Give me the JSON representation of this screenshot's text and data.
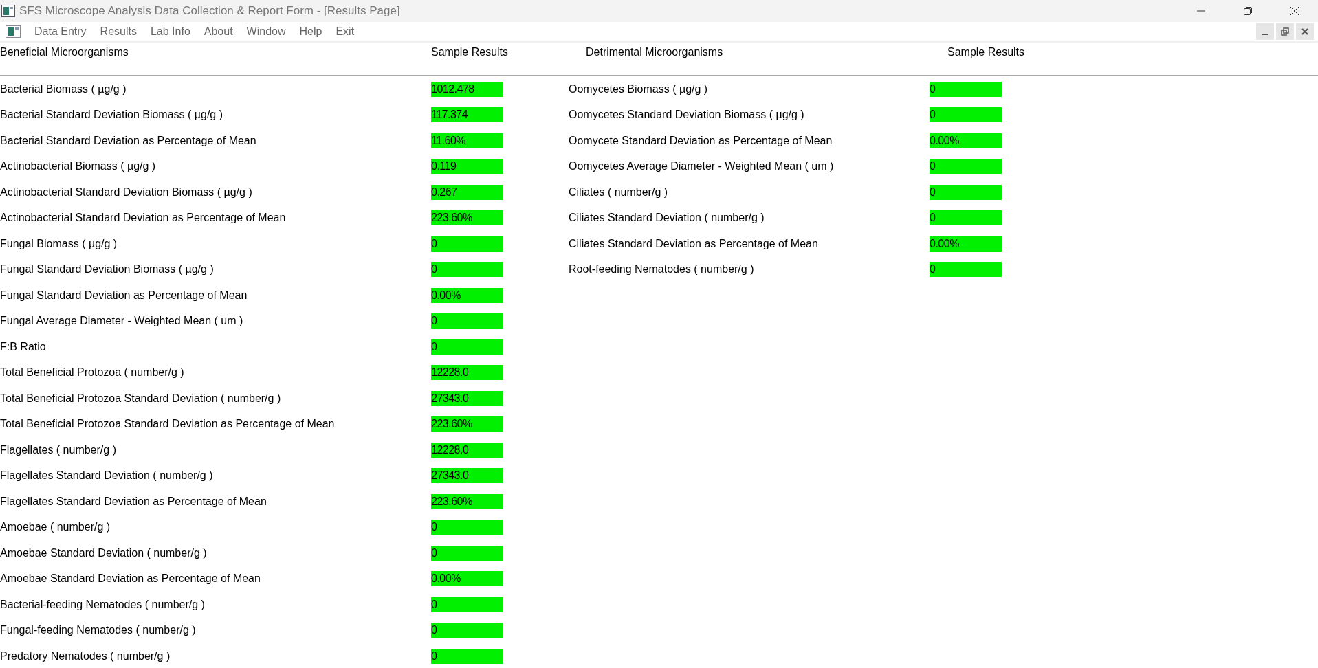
{
  "window": {
    "title": "SFS Microscope Analysis Data Collection & Report Form - [Results Page]"
  },
  "menu": [
    "Data Entry",
    "Results",
    "Lab Info",
    "About",
    "Window",
    "Help",
    "Exit"
  ],
  "beneficial": {
    "heading": "Beneficial Microorganisms",
    "results_heading": "Sample Results",
    "rows": [
      {
        "label": "Bacterial Biomass ( µg/g )",
        "value": "1012.478"
      },
      {
        "label": "Bacterial Standard Deviation Biomass ( µg/g )",
        "value": "117.374"
      },
      {
        "label": "Bacterial Standard Deviation as Percentage of Mean",
        "value": "11.60%"
      },
      {
        "label": "Actinobacterial Biomass ( µg/g )",
        "value": "0.119"
      },
      {
        "label": "Actinobacterial Standard Deviation Biomass ( µg/g )",
        "value": "0.267"
      },
      {
        "label": "Actinobacterial Standard Deviation as Percentage of Mean",
        "value": "223.60%"
      },
      {
        "label": "Fungal Biomass ( µg/g )",
        "value": "0"
      },
      {
        "label": "Fungal Standard Deviation Biomass ( µg/g )",
        "value": "0"
      },
      {
        "label": "Fungal Standard Deviation as Percentage of Mean",
        "value": "0.00%"
      },
      {
        "label": "Fungal Average Diameter - Weighted Mean ( um )",
        "value": "0"
      },
      {
        "label": "F:B Ratio",
        "value": "0"
      },
      {
        "label": "Total Beneficial Protozoa ( number/g )",
        "value": "12228.0"
      },
      {
        "label": "Total Beneficial Protozoa Standard Deviation ( number/g )",
        "value": "27343.0"
      },
      {
        "label": "Total Beneficial Protozoa Standard Deviation as Percentage of Mean",
        "value": "223.60%"
      },
      {
        "label": "Flagellates ( number/g )",
        "value": "12228.0"
      },
      {
        "label": "Flagellates Standard Deviation ( number/g )",
        "value": "27343.0"
      },
      {
        "label": "Flagellates Standard Deviation as Percentage of Mean",
        "value": "223.60%"
      },
      {
        "label": "Amoebae ( number/g )",
        "value": "0"
      },
      {
        "label": "Amoebae Standard Deviation ( number/g )",
        "value": "0"
      },
      {
        "label": "Amoebae Standard Deviation as Percentage of Mean",
        "value": "0.00%"
      },
      {
        "label": "Bacterial-feeding Nematodes ( number/g )",
        "value": "0"
      },
      {
        "label": "Fungal-feeding Nematodes ( number/g )",
        "value": "0"
      },
      {
        "label": "Predatory Nematodes ( number/g )",
        "value": "0"
      }
    ]
  },
  "detrimental": {
    "heading": "Detrimental Microorganisms",
    "results_heading": "Sample Results",
    "rows": [
      {
        "label": "Oomycetes Biomass ( µg/g )",
        "value": "0"
      },
      {
        "label": "Oomycetes Standard Deviation Biomass ( µg/g )",
        "value": "0"
      },
      {
        "label": "Oomycete Standard Deviation as Percentage of Mean",
        "value": "0.00%"
      },
      {
        "label": "Oomycetes Average Diameter - Weighted Mean ( um )",
        "value": "0"
      },
      {
        "label": "Ciliates ( number/g )",
        "value": "0"
      },
      {
        "label": "Ciliates Standard Deviation ( number/g )",
        "value": "0"
      },
      {
        "label": "Ciliates Standard Deviation as Percentage of Mean",
        "value": "0.00%"
      },
      {
        "label": "Root-feeding Nematodes ( number/g )",
        "value": "0"
      }
    ]
  }
}
